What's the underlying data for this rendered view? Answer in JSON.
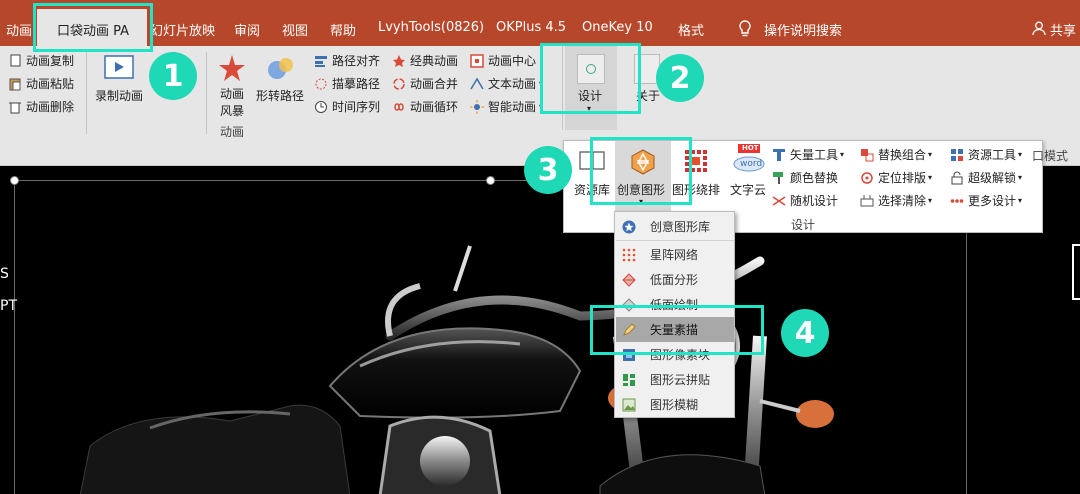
{
  "tabs": {
    "anim": "动画",
    "active": "口袋动画 PA",
    "slideshow": "幻灯片放映",
    "review": "审阅",
    "view": "视图",
    "help": "帮助",
    "lvyh": "LvyhTools(0826)",
    "okplus": "OKPlus 4.5",
    "onekey": "OneKey 10",
    "format": "格式",
    "search": "操作说明搜索",
    "share": "共享"
  },
  "ribbon": {
    "copy": "动画复制",
    "paste": "动画粘贴",
    "delete": "动画删除",
    "record": "录制动画",
    "storm_line1": "动画",
    "storm_line2": "风暴",
    "morph": "形转路径",
    "path_align": "路径对齐",
    "trace_path": "描摹路径",
    "timeline": "时间序列",
    "classic": "经典动画",
    "merge": "动画合并",
    "loop": "动画循环",
    "center": "动画中心",
    "text_anim": "文本动画",
    "smart_anim": "智能动画",
    "group_anim": "动画",
    "design": "设计",
    "about": "关于"
  },
  "design_panel": {
    "resource_lib": "资源库",
    "creative_graphics": "创意图形",
    "graphic_wrap": "图形绕排",
    "word_cloud": "文字云",
    "vector_tools": "矢量工具",
    "color_replace": "颜色替换",
    "random_design": "随机设计",
    "replace_combo": "替换组合",
    "locate_layout": "定位排版",
    "select_clear": "选择清除",
    "resource_tools": "资源工具",
    "super_unlock": "超级解锁",
    "more_design": "更多设计",
    "group_label": "设计",
    "window_mode": "口模式",
    "hot_badge": "HOT",
    "word_badge": "word"
  },
  "creative_menu": {
    "items": [
      "创意图形库",
      "星阵网络",
      "低面分形",
      "低面绘制",
      "矢量素描",
      "图形像素块",
      "图形云拼贴",
      "图形模糊"
    ]
  },
  "slide": {
    "left_text_1": "S",
    "left_text_2": "PT"
  },
  "badges": [
    "1",
    "2",
    "3",
    "4"
  ],
  "colors": {
    "accent_tab": "#b7472a",
    "highlight": "#20e3c8",
    "badge": "#1ed8b6"
  }
}
